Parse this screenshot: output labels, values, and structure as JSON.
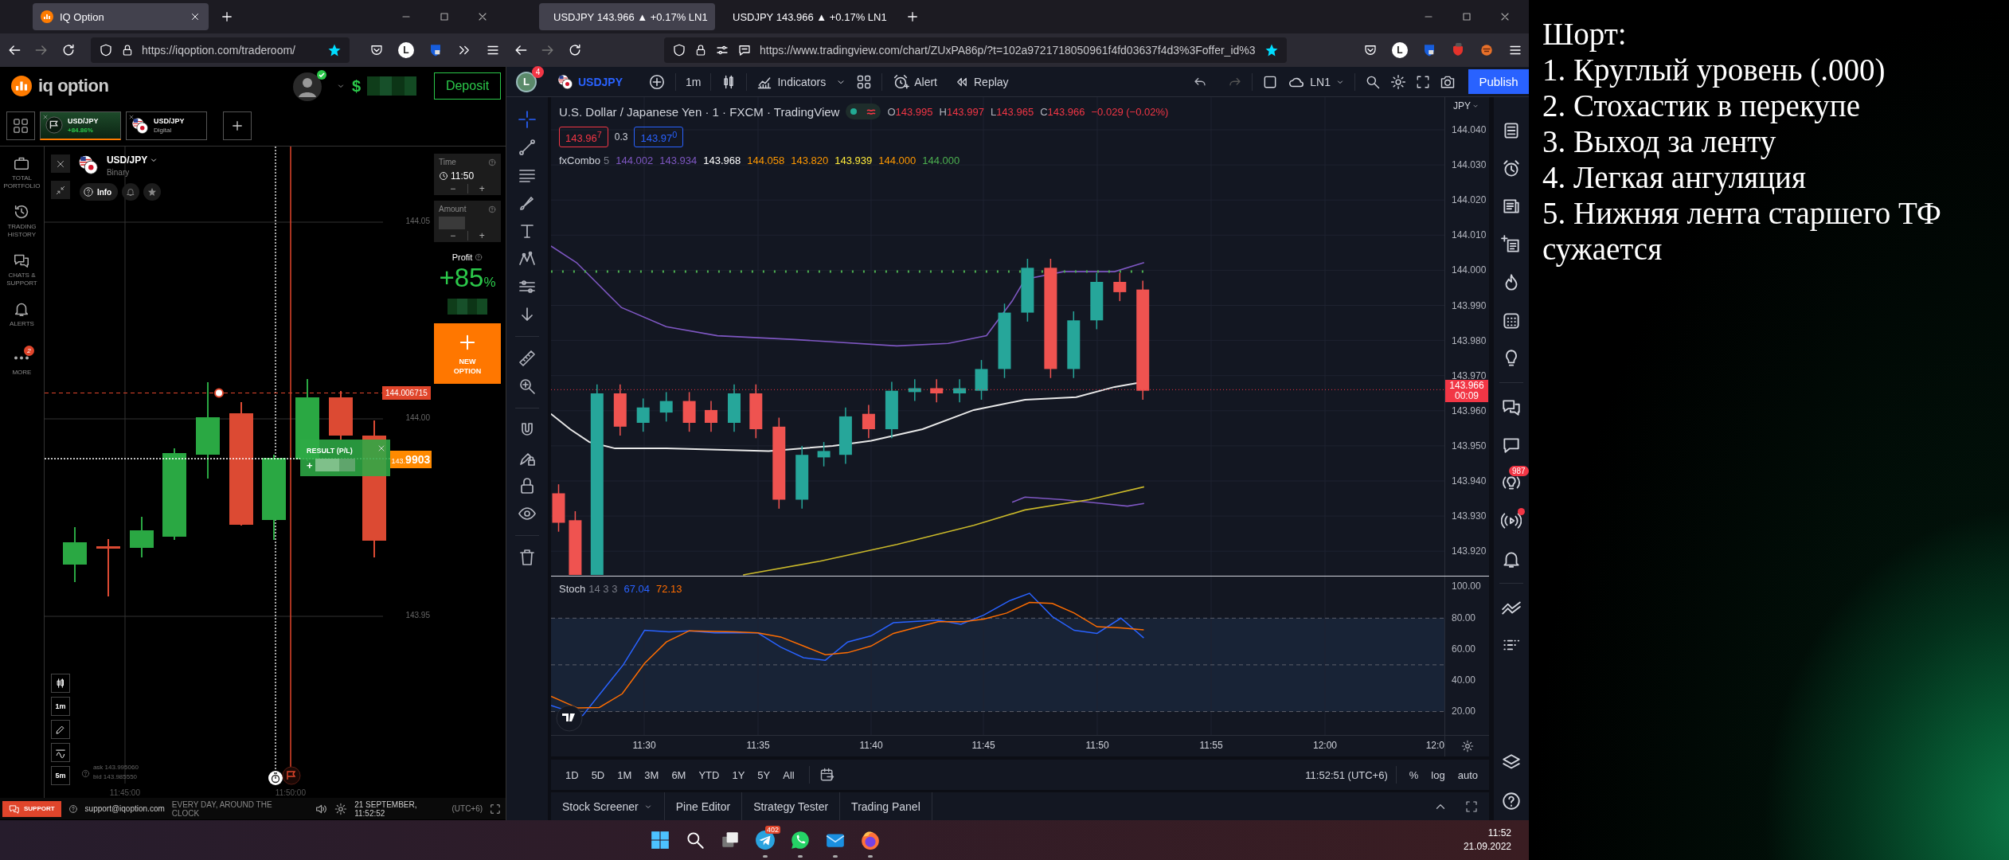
{
  "iq_window": {
    "browser": {
      "tabs": [
        {
          "title": "IQ Option",
          "selected": true
        }
      ],
      "url": "https://iqoption.com/traderoom/",
      "profile_letter": "L"
    },
    "logo": "iq option",
    "balance_symbol": "$",
    "deposit_button": "Deposit",
    "asset_tabs": [
      {
        "name": "USD/JPY",
        "detail": "+84.86%",
        "kind": "binary",
        "selected": true
      },
      {
        "name": "USD/JPY",
        "detail": "Digital",
        "kind": "digital",
        "selected": false
      }
    ],
    "sidebar": [
      {
        "label": "TOTAL PORTFOLIO"
      },
      {
        "label": "TRADING HISTORY"
      },
      {
        "label": "CHATS & SUPPORT"
      },
      {
        "label": "ALERTS"
      },
      {
        "label": "MORE",
        "badge": "2"
      }
    ],
    "asset": {
      "name": "USD/JPY",
      "type": "Binary",
      "info_button": "Info"
    },
    "time_panel": {
      "label": "Time",
      "value": "11:50",
      "minus": "−",
      "plus": "+"
    },
    "amount_panel": {
      "label": "Amount",
      "minus": "−",
      "plus": "+"
    },
    "profit": {
      "label": "Profit",
      "value": "+85",
      "unit": "%"
    },
    "new_option_button": "NEW OPTION",
    "price_levels": [
      "144.05",
      "144.00",
      "143.95"
    ],
    "strike_price": "144.006715",
    "current_price": {
      "prefix": "143.",
      "digits": "9903"
    },
    "result_popup": {
      "title": "RESULT (P/L)",
      "sign": "+"
    },
    "interval_buttons": [
      "1m",
      "5m"
    ],
    "quotes": [
      "ask 143.995060",
      "bid 143.985550"
    ],
    "time_labels": [
      "11:45:00",
      "11:50:00"
    ],
    "footer": {
      "support_button": "SUPPORT",
      "email": "support@iqoption.com",
      "hours": "EVERY DAY, AROUND THE CLOCK",
      "datetime": "21 SEPTEMBER, 11:52:52",
      "timezone": "(UTC+6)"
    }
  },
  "tv_window": {
    "browser": {
      "tabs": [
        {
          "title": "USDJPY 143.966 ▲ +0.17% LN1",
          "selected": true
        },
        {
          "title": "USDJPY 143.966 ▲ +0.17% LN1",
          "selected": false
        }
      ],
      "url": "https://www.tradingview.com/chart/ZUxPA86p/?t=102a9721718050961f4fd03637f4d3%3Foffer_id%3",
      "profile_letter": "L"
    },
    "toolbar": {
      "avatar": "L",
      "avatar_badge": "4",
      "symbol": "USDJPY",
      "interval": "1m",
      "indicators": "Indicators",
      "alert": "Alert",
      "replay": "Replay",
      "layout": "LN1",
      "publish": "Publish"
    },
    "legend": {
      "title": "U.S. Dollar / Japanese Yen · 1 · FXCM · TradingView",
      "ohlc": [
        {
          "key": "O",
          "value": "143.995"
        },
        {
          "key": "H",
          "value": "143.997"
        },
        {
          "key": "L",
          "value": "143.965"
        },
        {
          "key": "C",
          "value": "143.966"
        }
      ],
      "change": "−0.029 (−0.02%)"
    },
    "quote": {
      "bid": "143.96$^{7}$",
      "spread": "0.3",
      "ask": "143.97$^{0}$"
    },
    "indicator": {
      "name": "fxCombo",
      "param": "5",
      "values": [
        {
          "value": "144.002",
          "color": "#7e57c2"
        },
        {
          "value": "143.934",
          "color": "#7e57c2"
        },
        {
          "value": "143.968",
          "color": "#ffffff"
        },
        {
          "value": "144.058",
          "color": "#ff9800"
        },
        {
          "value": "143.820",
          "color": "#ff9800"
        },
        {
          "value": "143.939",
          "color": "#ffeb3b"
        },
        {
          "value": "144.000",
          "color": "#ff9800"
        },
        {
          "value": "144.000",
          "color": "#4caf50"
        }
      ]
    },
    "price_axis": {
      "currency": "JPY",
      "ticks": [
        "144.040",
        "144.030",
        "144.020",
        "144.010",
        "144.000",
        "143.990",
        "143.980",
        "143.970",
        "143.960",
        "143.950",
        "143.940",
        "143.930",
        "143.920"
      ],
      "last_price": "143.966",
      "countdown": "00:09"
    },
    "stoch": {
      "name": "Stoch",
      "params": "14 3 3",
      "values": [
        {
          "value": "67.04",
          "color": "#2962ff"
        },
        {
          "value": "72.13",
          "color": "#ff6d00"
        }
      ],
      "ticks": [
        "100.00",
        "80.00",
        "60.00",
        "40.00",
        "20.00"
      ]
    },
    "time_axis": [
      "11:30",
      "11:35",
      "11:40",
      "11:45",
      "11:50",
      "11:55",
      "12:00",
      "12:0"
    ],
    "ranges": [
      "1D",
      "5D",
      "1M",
      "3M",
      "6M",
      "YTD",
      "1Y",
      "5Y",
      "All"
    ],
    "clock": "11:52:51 (UTC+6)",
    "scale_options": [
      "%",
      "log",
      "auto"
    ],
    "bottom_tabs": [
      "Stock Screener",
      "Pine Editor",
      "Strategy Tester",
      "Trading Panel"
    ],
    "sidebar_badge": "987"
  },
  "notes": {
    "title": "Шорт:",
    "items": [
      "1. Круглый уровень (.000)",
      "2. Стохастик в перекупе",
      "3. Выход за ленту",
      "4. Легкая ангуляция",
      "5. Нижняя лента старшего ТФ сужается"
    ]
  },
  "taskbar": {
    "apps": [
      {
        "kind": "start",
        "running": false
      },
      {
        "kind": "search",
        "running": false
      },
      {
        "kind": "taskview",
        "running": false
      },
      {
        "kind": "telegram",
        "running": true,
        "badge": "402"
      },
      {
        "kind": "whatsapp",
        "running": true
      },
      {
        "kind": "mail",
        "running": true
      },
      {
        "kind": "firefox",
        "running": true
      }
    ],
    "time": "11:52",
    "date": "21.09.2022"
  }
}
